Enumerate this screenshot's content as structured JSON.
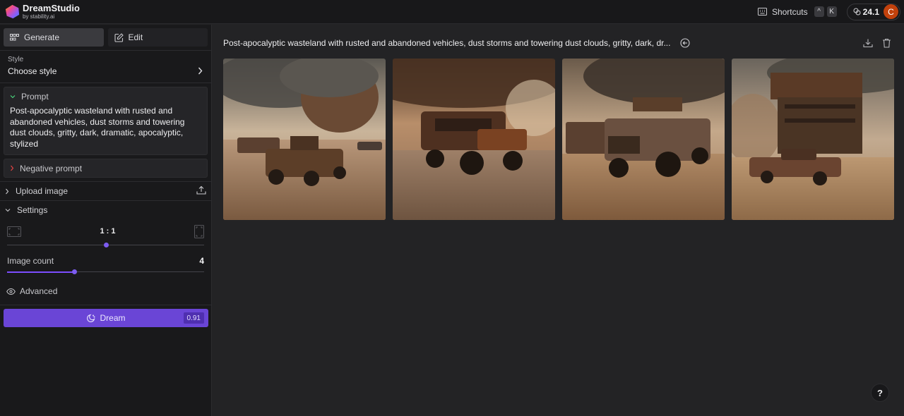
{
  "app": {
    "title": "DreamStudio",
    "subtitle": "by stability.ai"
  },
  "topbar": {
    "shortcuts_label": "Shortcuts",
    "shortcut_keys": [
      "^",
      "K"
    ],
    "credits": "24.1",
    "avatar_initial": "C",
    "avatar_color": "#c2410c"
  },
  "sidebar": {
    "tabs": [
      {
        "label": "Generate",
        "icon": "grid-icon",
        "active": true
      },
      {
        "label": "Edit",
        "icon": "edit-icon",
        "active": false
      }
    ],
    "style": {
      "label": "Style",
      "value": "Choose style"
    },
    "prompt": {
      "label": "Prompt",
      "text": "Post-apocalyptic wasteland with rusted and abandoned vehicles, dust storms and towering dust clouds, gritty, dark, dramatic, apocalyptic, stylized"
    },
    "negative_prompt": {
      "label": "Negative prompt"
    },
    "upload_image": {
      "label": "Upload image"
    },
    "settings": {
      "label": "Settings",
      "aspect_ratio": "1 : 1",
      "aspect_ratio_slider_percent": 50,
      "image_count_label": "Image count",
      "image_count": "4",
      "image_count_slider_percent": 34
    },
    "advanced": {
      "label": "Advanced"
    },
    "dream_button": {
      "label": "Dream",
      "cost": "0.91",
      "color": "#6a45d6"
    }
  },
  "main": {
    "generation_prompt": "Post-apocalyptic wasteland with rusted and abandoned vehicles, dust storms and towering dust clouds, gritty, dark, dr...",
    "images": [
      {
        "alt": "Rusted SUV in desert wasteland with towering dust cloud"
      },
      {
        "alt": "Rusted off-road truck under dark dust storm"
      },
      {
        "alt": "Rusted lifted SUV with wreckage and bus in desert"
      },
      {
        "alt": "Rusted sedan in front of derelict tower structure"
      }
    ],
    "help_label": "?"
  },
  "colors": {
    "accent": "#7c4dff",
    "background": "#232325",
    "sidebar": "#19191b"
  }
}
